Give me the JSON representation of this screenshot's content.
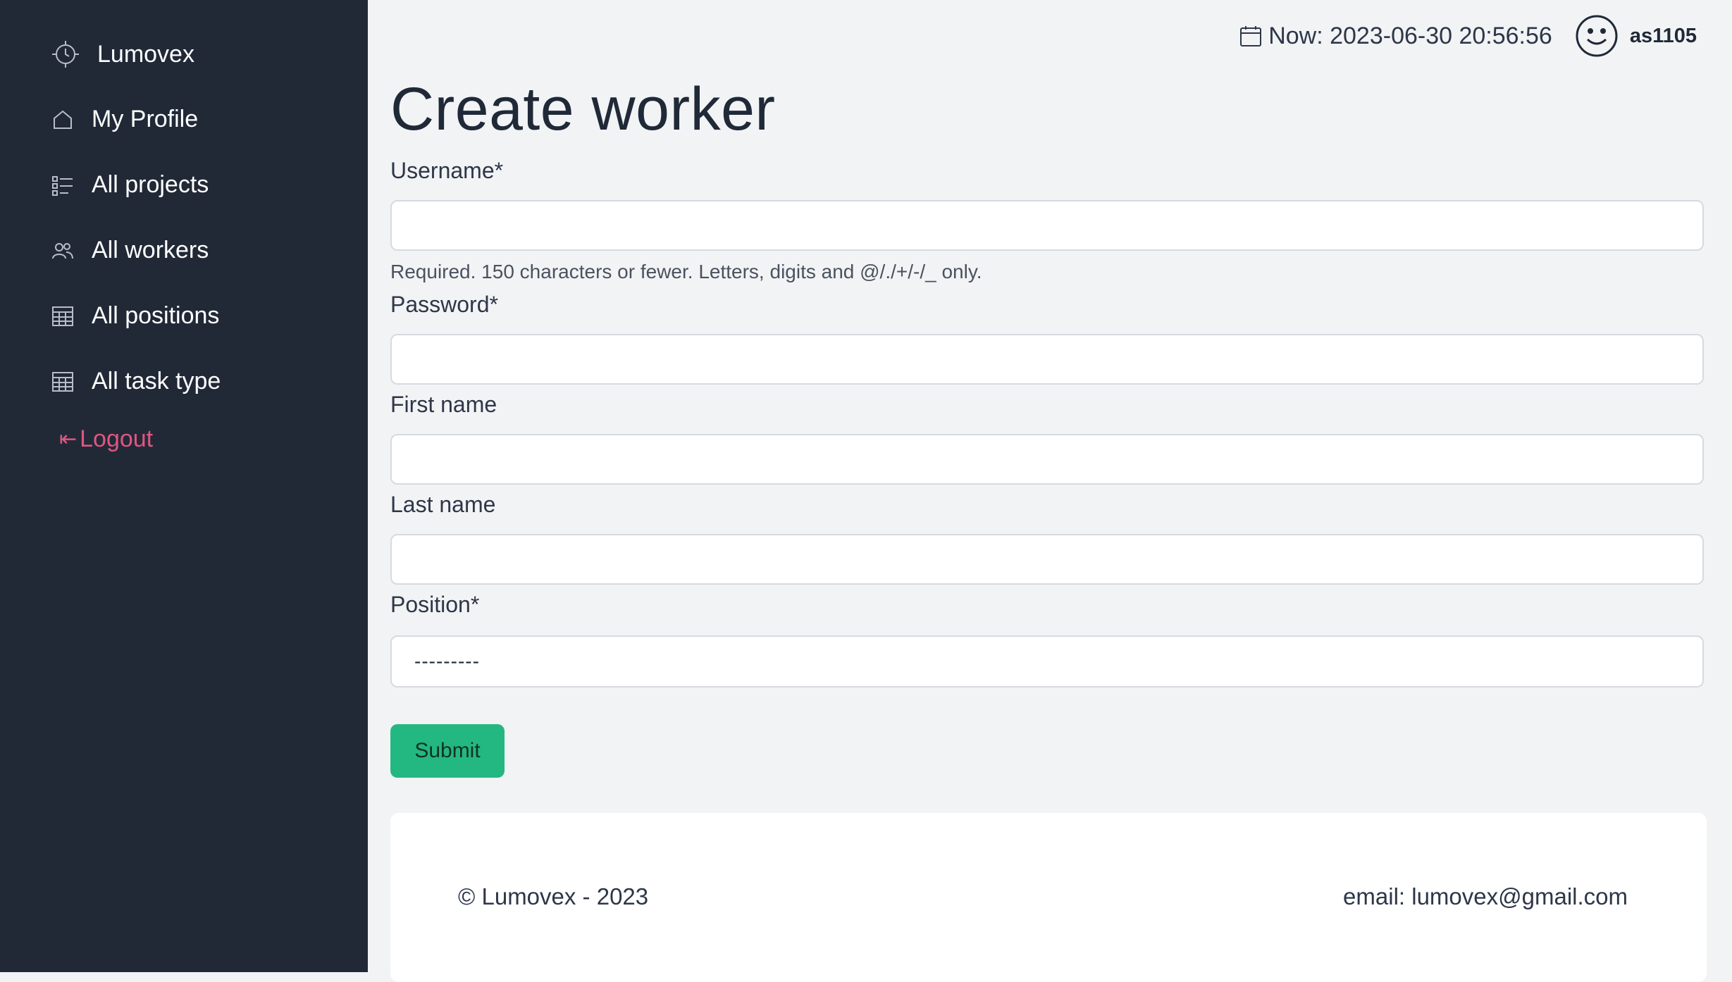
{
  "sidebar": {
    "brand": "Lumovex",
    "items": [
      {
        "label": "My Profile",
        "icon": "home-icon"
      },
      {
        "label": "All projects",
        "icon": "checklist-icon"
      },
      {
        "label": "All workers",
        "icon": "users-icon"
      },
      {
        "label": "All positions",
        "icon": "table-icon"
      },
      {
        "label": "All task type",
        "icon": "table-icon"
      }
    ],
    "logout": "Logout"
  },
  "topbar": {
    "now": "Now: 2023-06-30 20:56:56",
    "username": "as1105"
  },
  "page": {
    "title": "Create worker"
  },
  "form": {
    "username_label": "Username*",
    "username_value": "",
    "username_help": "Required. 150 characters or fewer. Letters, digits and @/./+/-/_ only.",
    "password_label": "Password*",
    "password_value": "",
    "first_name_label": "First name",
    "first_name_value": "",
    "last_name_label": "Last name",
    "last_name_value": "",
    "position_label": "Position*",
    "position_selected": "---------",
    "submit_label": "Submit"
  },
  "footer": {
    "copyright": "© Lumovex - 2023",
    "email": "email: lumovex@gmail.com"
  },
  "colors": {
    "sidebar_bg": "#212937",
    "page_bg": "#f2f3f5",
    "accent_green": "#23b882",
    "logout_pink": "#e0567f"
  }
}
